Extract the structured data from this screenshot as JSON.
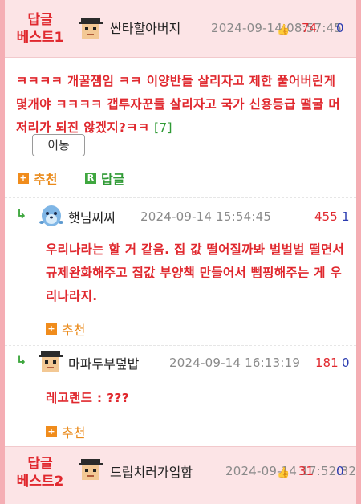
{
  "best1": {
    "label_line1": "답글",
    "label_line2": "베스트1",
    "author": "싼타할아버지",
    "date": "2024-09-14 08:57:45",
    "votes_up": "74",
    "votes_down": "0",
    "body": "ㅋㅋㅋㅋ 개꿀잼임 ㅋㅋ 이양반들 살리자고 제한 풀어버린게 몇개야 ㅋㅋㅋㅋ 갭투자꾼들 살리자고 국가 신용등급 떨굴 머저리가 되진 않겠지?ㅋㅋ",
    "reply_count": "[7]",
    "move_button": "이동",
    "recommend": "추천",
    "reply": "답글"
  },
  "comments": [
    {
      "author": "햇님찌찌",
      "date": "2024-09-14 15:54:45",
      "votes_up": "455",
      "votes_down": "1",
      "body": "우리나라는 할 거 같음. 집 값 떨어질까봐 벌벌벌 떨면서 규제완화해주고 집값 부양책 만들어서 뻠핑해주는 게 우리나라지.",
      "recommend": "추천"
    },
    {
      "author": "마파두부덮밥",
      "date": "2024-09-14 16:13:19",
      "votes_up": "181",
      "votes_down": "0",
      "body": "레고랜드 : ???",
      "recommend": "추천"
    }
  ],
  "best2": {
    "label_line1": "답글",
    "label_line2": "베스트2",
    "author": "드립치러가입함",
    "date": "2024-09-14 17:52:32",
    "votes_up": "31",
    "votes_down": "0"
  },
  "icons": {
    "avatar": "pixel-face-avatar-icon",
    "dolphin": "blue-seal-avatar-icon",
    "thumb": "thumbs-up-icon",
    "reply_arrow": "reply-arrow-icon",
    "plus": "plus-box-icon",
    "reply_box": "r-box-icon"
  },
  "colors": {
    "accent_red": "#e0282e",
    "frame_pink": "#f5aeb4",
    "recommend_orange": "#f08c1c",
    "reply_green": "#3fa73f",
    "vote_down_blue": "#2a3bb0"
  }
}
